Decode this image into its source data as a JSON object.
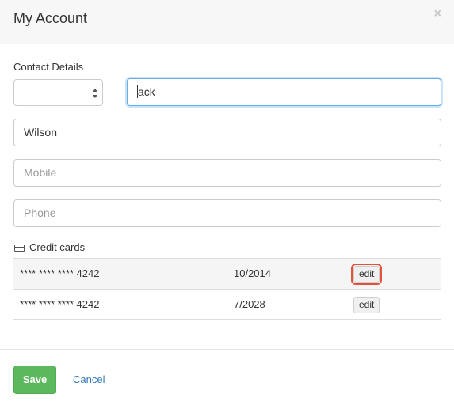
{
  "dialog": {
    "title": "My Account",
    "close_glyph": "×"
  },
  "contact": {
    "label": "Contact Details",
    "salutation_select": {
      "value": ""
    },
    "first_name": {
      "value": "ack",
      "focused": true
    },
    "last_name": {
      "value": "Wilson"
    },
    "mobile": {
      "placeholder": "Mobile"
    },
    "phone": {
      "placeholder": "Phone"
    }
  },
  "credit_cards": {
    "label": "Credit cards",
    "icon": "credit-card-icon",
    "rows": [
      {
        "number": "**** **** **** 4242",
        "expiry": "10/2014",
        "edit_label": "edit"
      },
      {
        "number": "**** **** **** 4242",
        "expiry": "7/2028",
        "edit_label": "edit"
      }
    ]
  },
  "footer": {
    "save_label": "Save",
    "cancel_label": "Cancel"
  },
  "colors": {
    "save_button": "#5cb85c",
    "link": "#337ab7",
    "focus_border": "#66afe9",
    "highlight_outline": "#e4513a"
  }
}
